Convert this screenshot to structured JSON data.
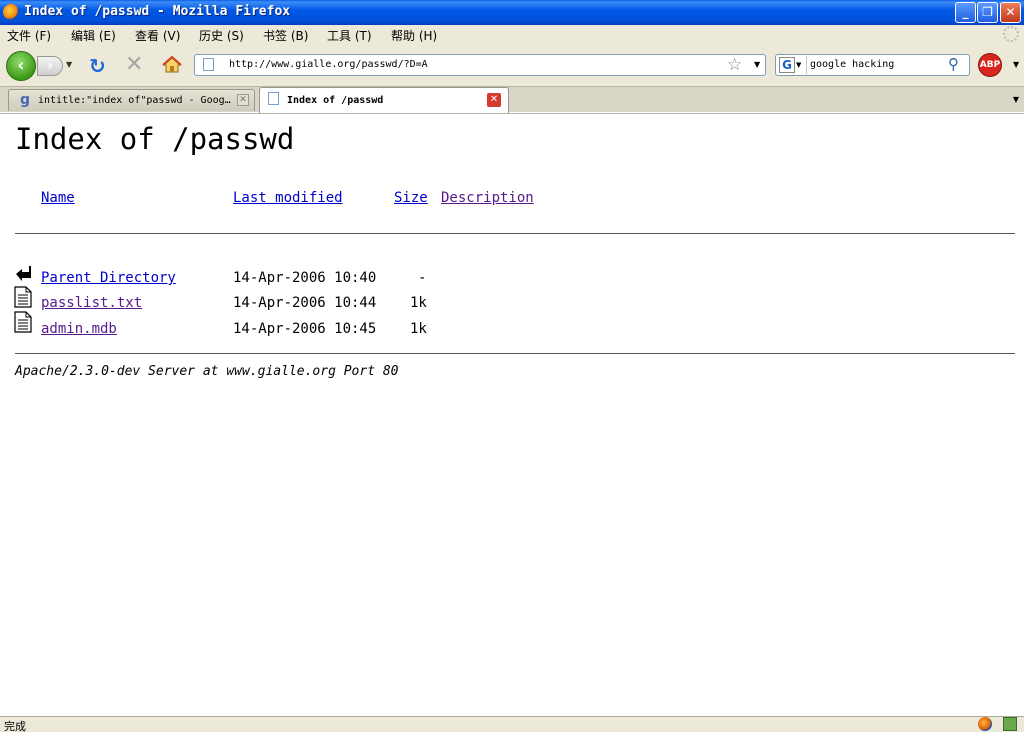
{
  "window": {
    "title": "Index of /passwd - Mozilla Firefox"
  },
  "menu": [
    "文件 (F)",
    "编辑 (E)",
    "查看 (V)",
    "历史 (S)",
    "书签 (B)",
    "工具 (T)",
    "帮助 (H)"
  ],
  "nav": {
    "url": "http://www.gialle.org/passwd/?D=A",
    "search_query": "google hacking",
    "search_engine_icon": "G",
    "abp_label": "ABP"
  },
  "tabs": [
    {
      "label": "intitle:\"index of\"passwd - Goog…",
      "icon": "g"
    },
    {
      "label": "Index of /passwd",
      "active": true
    }
  ],
  "page": {
    "heading": "Index of /passwd",
    "columns": [
      "Name",
      "Last modified",
      "Size",
      "Description"
    ],
    "rows": [
      {
        "name": "Parent Directory",
        "modified": "14-Apr-2006 10:40",
        "size": "-",
        "icon": "back-icon"
      },
      {
        "name": "passlist.txt",
        "modified": "14-Apr-2006 10:44",
        "size": "1k",
        "icon": "text-file-icon"
      },
      {
        "name": "admin.mdb",
        "modified": "14-Apr-2006 10:45",
        "size": "1k",
        "icon": "text-file-icon"
      }
    ],
    "signature": "Apache/2.3.0-dev Server at www.gialle.org Port 80"
  },
  "status": {
    "text": "完成"
  }
}
